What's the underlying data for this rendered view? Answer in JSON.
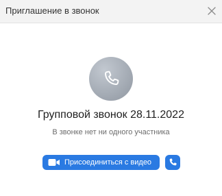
{
  "dialog": {
    "title": "Приглашение в звонок"
  },
  "call": {
    "title": "Групповой звонок 28.11.2022",
    "participants_status": "В звонке нет ни одного участника",
    "avatar_icon": "phone-icon"
  },
  "actions": {
    "join_video_label": "Присоединиться с видео",
    "join_video_icon": "video-camera-icon",
    "join_audio_icon": "phone-icon"
  },
  "colors": {
    "header_background": "#f3f3f3",
    "accent": "#2a7ae2",
    "avatar_background": "#a6adb6",
    "subtitle_text": "#6b6b6b"
  }
}
